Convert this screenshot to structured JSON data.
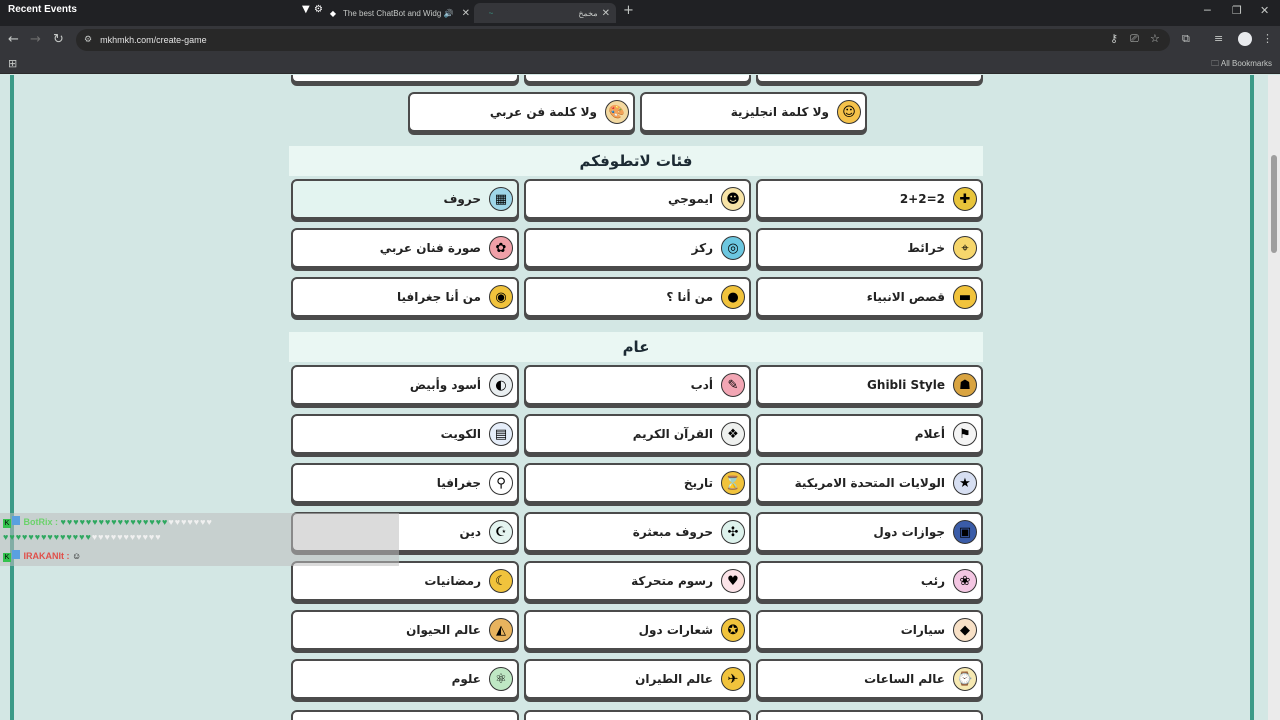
{
  "titlebar": {
    "overlay_title": "Recent Events",
    "tabs": [
      {
        "title": "The best ChatBot and Widg"
      },
      {
        "title": "مخمخ"
      }
    ]
  },
  "toolbar": {
    "url": "mkhmkh.com/create-game"
  },
  "bookmarks": {
    "all_label": "All Bookmarks"
  },
  "sections": [
    {
      "title": "فئات لاتطوفكم"
    },
    {
      "title": "عام"
    }
  ],
  "top_cards": [
    {
      "label": "ولا كلمة انجليزية",
      "icon": "smiley-icon",
      "glyph": "☺",
      "bg": "#f5c24a"
    },
    {
      "label": "ولا كلمة فن عربي",
      "icon": "palette-icon",
      "glyph": "🎨",
      "bg": "#f3d9a0"
    }
  ],
  "s1_cards": [
    {
      "label": "2+2=2",
      "icon": "puzzle-icon",
      "glyph": "✚",
      "bg": "#e8c43a"
    },
    {
      "label": "ايموجي",
      "icon": "emoji-icon",
      "glyph": "☻",
      "bg": "#f7e3a6"
    },
    {
      "label": "حروف",
      "icon": "letters-grid-icon",
      "glyph": "▦",
      "bg": "#9fd6e8"
    },
    {
      "label": "خرائط",
      "icon": "map-pin-icon",
      "glyph": "⌖",
      "bg": "#f6d66c"
    },
    {
      "label": "ركز",
      "icon": "focus-icon",
      "glyph": "◎",
      "bg": "#6cc7e0"
    },
    {
      "label": "صورة فنان عربي",
      "icon": "artist-icon",
      "glyph": "✿",
      "bg": "#f0a0a8"
    },
    {
      "label": "قصص الانبياء",
      "icon": "book-icon",
      "glyph": "▬",
      "bg": "#f1c33c"
    },
    {
      "label": "من أنا ؟",
      "icon": "person-silhouette-icon",
      "glyph": "●",
      "bg": "#f1c33c"
    },
    {
      "label": "من أنا جغرافيا",
      "icon": "globe-icon",
      "glyph": "◉",
      "bg": "#f1c33c"
    }
  ],
  "s2_cards": [
    {
      "label": "Ghibli Style",
      "icon": "ghibli-icon",
      "glyph": "☗",
      "bg": "#d9a441"
    },
    {
      "label": "أدب",
      "icon": "pen-icon",
      "glyph": "✎",
      "bg": "#f2a6b4"
    },
    {
      "label": "أسود وأبيض",
      "icon": "monochrome-icon",
      "glyph": "◐",
      "bg": "#e9eef0"
    },
    {
      "label": "أعلام",
      "icon": "flag-icon",
      "glyph": "⚑",
      "bg": "#f4f4f4"
    },
    {
      "label": "القرآن الكريم",
      "icon": "quran-icon",
      "glyph": "❖",
      "bg": "#eef0ee"
    },
    {
      "label": "الكويت",
      "icon": "kuwait-icon",
      "glyph": "▤",
      "bg": "#e6eefa"
    },
    {
      "label": "الولايات المتحدة الامريكية",
      "icon": "usa-flag-icon",
      "glyph": "★",
      "bg": "#d7dff2"
    },
    {
      "label": "تاريخ",
      "icon": "history-icon",
      "glyph": "⌛",
      "bg": "#f1c33c"
    },
    {
      "label": "جغرافيا",
      "icon": "location-pin-icon",
      "glyph": "⚲",
      "bg": "#ffffff"
    },
    {
      "label": "جوازات دول",
      "icon": "passport-icon",
      "glyph": "▣",
      "bg": "#3a5ca8"
    },
    {
      "label": "حروف مبعثرة",
      "icon": "scattered-letters-icon",
      "glyph": "✣",
      "bg": "#ddf2ec"
    },
    {
      "label": "دين",
      "icon": "mosque-icon",
      "glyph": "☪",
      "bg": "#e4f4f0"
    },
    {
      "label": "رئب",
      "icon": "bunny-icon",
      "glyph": "❀",
      "bg": "#f3c6e2"
    },
    {
      "label": "رسوم متحركة",
      "icon": "cartoon-icon",
      "glyph": "♥",
      "bg": "#fbe3e8"
    },
    {
      "label": "رمضانيات",
      "icon": "ramadan-icon",
      "glyph": "☾",
      "bg": "#f1c33c"
    },
    {
      "label": "سيارات",
      "icon": "car-icon",
      "glyph": "◆",
      "bg": "#f7e0c6"
    },
    {
      "label": "شعارات دول",
      "icon": "emblem-icon",
      "glyph": "✪",
      "bg": "#f1c33c"
    },
    {
      "label": "عالم الحيوان",
      "icon": "animal-icon",
      "glyph": "◭",
      "bg": "#e8b35e"
    },
    {
      "label": "عالم الساعات",
      "icon": "watch-icon",
      "glyph": "⌚",
      "bg": "#f6e9b2"
    },
    {
      "label": "عالم الطيران",
      "icon": "plane-icon",
      "glyph": "✈",
      "bg": "#f1c33c"
    },
    {
      "label": "علوم",
      "icon": "atom-icon",
      "glyph": "⚛",
      "bg": "#bfe8c4"
    }
  ],
  "chat": {
    "user1": "BotRix :",
    "user2": "IRAKANIt :",
    "hearts_line1": "♥♥♥♥♥♥♥♥♥♥♥♥♥♥♥♥♥",
    "hearts_line1_w": "♥♥♥♥♥♥♥",
    "hearts_line2": "♥♥♥♥♥♥♥♥♥♥♥♥♥♥",
    "hearts_line2_w": "♥♥♥♥♥♥♥♥♥♥♥"
  }
}
